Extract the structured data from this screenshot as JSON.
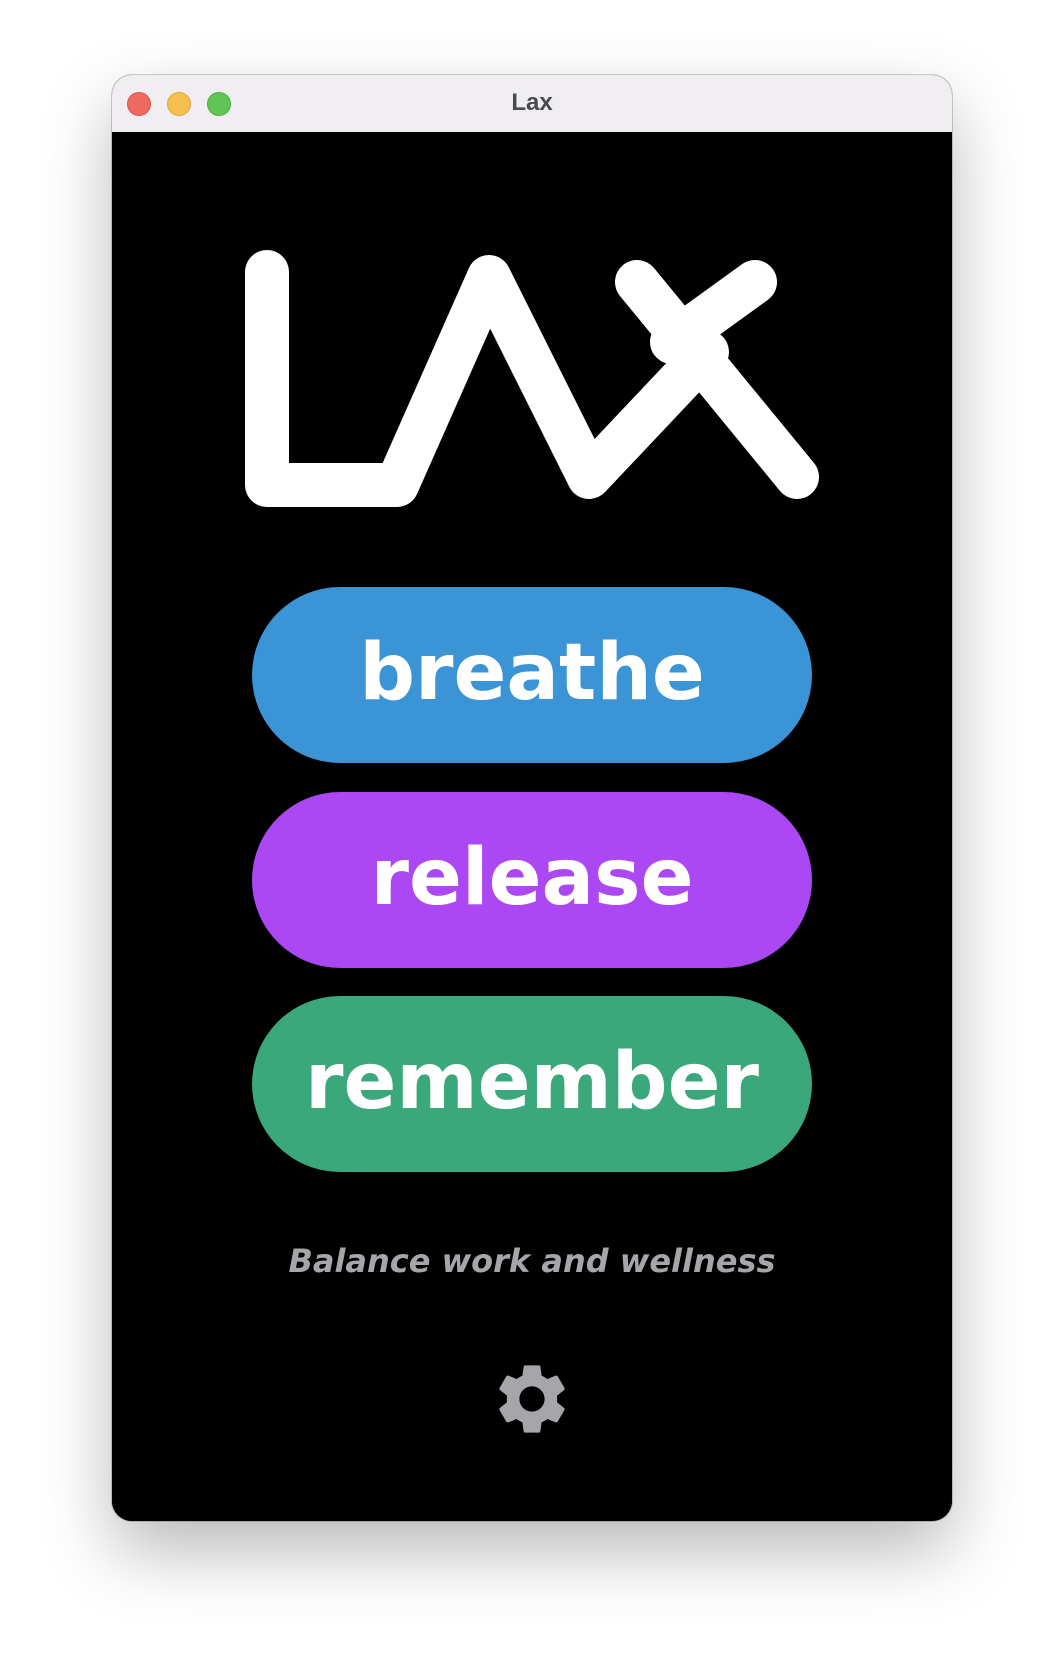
{
  "window": {
    "title": "Lax"
  },
  "logo": {
    "text": "LAX"
  },
  "actions": [
    {
      "label": "breathe",
      "color": "#3a94d5"
    },
    {
      "label": "release",
      "color": "#ab47f3"
    },
    {
      "label": "remember",
      "color": "#3aa87b"
    }
  ],
  "tagline": "Balance work and wellness",
  "settings": {
    "icon": "gear-icon",
    "color": "#a6a6aa"
  }
}
